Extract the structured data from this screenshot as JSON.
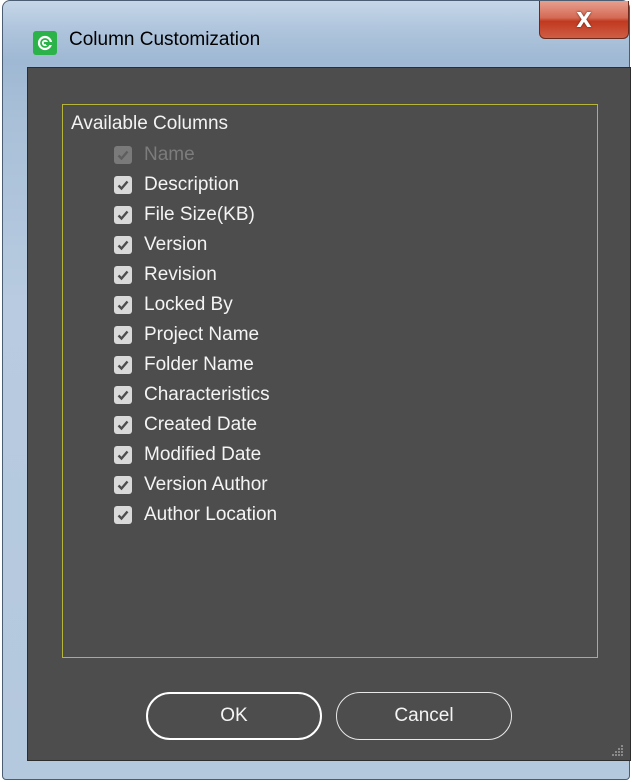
{
  "window": {
    "title": "Column Customization",
    "close_glyph": "X",
    "app_icon": "refresh-circle-icon",
    "accent_color": "#2bb34a"
  },
  "group": {
    "title": "Available Columns",
    "border_color": "#b7b43a"
  },
  "columns": [
    {
      "label": "Name",
      "checked": true,
      "enabled": false
    },
    {
      "label": "Description",
      "checked": true,
      "enabled": true
    },
    {
      "label": "File Size(KB)",
      "checked": true,
      "enabled": true
    },
    {
      "label": "Version",
      "checked": true,
      "enabled": true
    },
    {
      "label": "Revision",
      "checked": true,
      "enabled": true
    },
    {
      "label": "Locked By",
      "checked": true,
      "enabled": true
    },
    {
      "label": "Project Name",
      "checked": true,
      "enabled": true
    },
    {
      "label": "Folder Name",
      "checked": true,
      "enabled": true
    },
    {
      "label": "Characteristics",
      "checked": true,
      "enabled": true
    },
    {
      "label": "Created Date",
      "checked": true,
      "enabled": true
    },
    {
      "label": "Modified Date",
      "checked": true,
      "enabled": true
    },
    {
      "label": "Version Author",
      "checked": true,
      "enabled": true
    },
    {
      "label": "Author Location",
      "checked": true,
      "enabled": true
    }
  ],
  "buttons": {
    "ok_label": "OK",
    "cancel_label": "Cancel"
  }
}
